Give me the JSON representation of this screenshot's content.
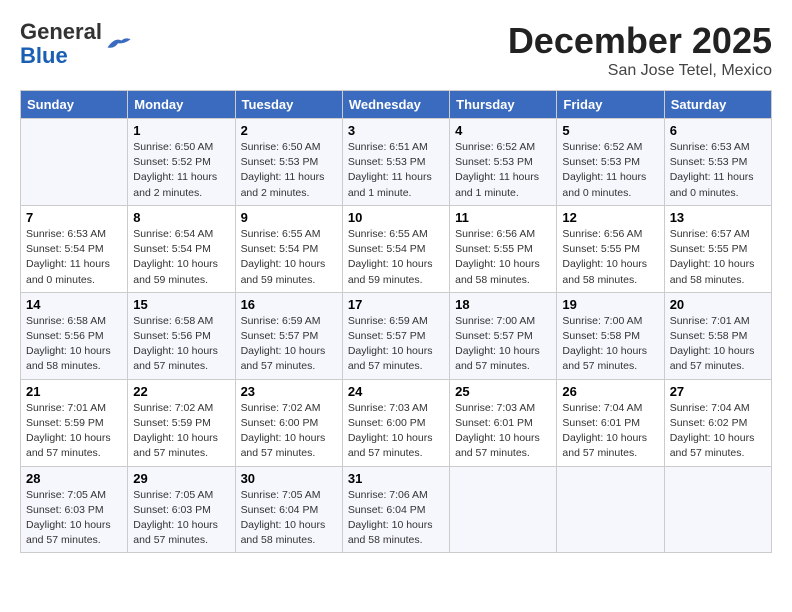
{
  "header": {
    "logo_general": "General",
    "logo_blue": "Blue",
    "month_title": "December 2025",
    "location": "San Jose Tetel, Mexico"
  },
  "weekdays": [
    "Sunday",
    "Monday",
    "Tuesday",
    "Wednesday",
    "Thursday",
    "Friday",
    "Saturday"
  ],
  "weeks": [
    [
      {
        "day": "",
        "sunrise": "",
        "sunset": "",
        "daylight": ""
      },
      {
        "day": "1",
        "sunrise": "Sunrise: 6:50 AM",
        "sunset": "Sunset: 5:52 PM",
        "daylight": "Daylight: 11 hours and 2 minutes."
      },
      {
        "day": "2",
        "sunrise": "Sunrise: 6:50 AM",
        "sunset": "Sunset: 5:53 PM",
        "daylight": "Daylight: 11 hours and 2 minutes."
      },
      {
        "day": "3",
        "sunrise": "Sunrise: 6:51 AM",
        "sunset": "Sunset: 5:53 PM",
        "daylight": "Daylight: 11 hours and 1 minute."
      },
      {
        "day": "4",
        "sunrise": "Sunrise: 6:52 AM",
        "sunset": "Sunset: 5:53 PM",
        "daylight": "Daylight: 11 hours and 1 minute."
      },
      {
        "day": "5",
        "sunrise": "Sunrise: 6:52 AM",
        "sunset": "Sunset: 5:53 PM",
        "daylight": "Daylight: 11 hours and 0 minutes."
      },
      {
        "day": "6",
        "sunrise": "Sunrise: 6:53 AM",
        "sunset": "Sunset: 5:53 PM",
        "daylight": "Daylight: 11 hours and 0 minutes."
      }
    ],
    [
      {
        "day": "7",
        "sunrise": "Sunrise: 6:53 AM",
        "sunset": "Sunset: 5:54 PM",
        "daylight": "Daylight: 11 hours and 0 minutes."
      },
      {
        "day": "8",
        "sunrise": "Sunrise: 6:54 AM",
        "sunset": "Sunset: 5:54 PM",
        "daylight": "Daylight: 10 hours and 59 minutes."
      },
      {
        "day": "9",
        "sunrise": "Sunrise: 6:55 AM",
        "sunset": "Sunset: 5:54 PM",
        "daylight": "Daylight: 10 hours and 59 minutes."
      },
      {
        "day": "10",
        "sunrise": "Sunrise: 6:55 AM",
        "sunset": "Sunset: 5:54 PM",
        "daylight": "Daylight: 10 hours and 59 minutes."
      },
      {
        "day": "11",
        "sunrise": "Sunrise: 6:56 AM",
        "sunset": "Sunset: 5:55 PM",
        "daylight": "Daylight: 10 hours and 58 minutes."
      },
      {
        "day": "12",
        "sunrise": "Sunrise: 6:56 AM",
        "sunset": "Sunset: 5:55 PM",
        "daylight": "Daylight: 10 hours and 58 minutes."
      },
      {
        "day": "13",
        "sunrise": "Sunrise: 6:57 AM",
        "sunset": "Sunset: 5:55 PM",
        "daylight": "Daylight: 10 hours and 58 minutes."
      }
    ],
    [
      {
        "day": "14",
        "sunrise": "Sunrise: 6:58 AM",
        "sunset": "Sunset: 5:56 PM",
        "daylight": "Daylight: 10 hours and 58 minutes."
      },
      {
        "day": "15",
        "sunrise": "Sunrise: 6:58 AM",
        "sunset": "Sunset: 5:56 PM",
        "daylight": "Daylight: 10 hours and 57 minutes."
      },
      {
        "day": "16",
        "sunrise": "Sunrise: 6:59 AM",
        "sunset": "Sunset: 5:57 PM",
        "daylight": "Daylight: 10 hours and 57 minutes."
      },
      {
        "day": "17",
        "sunrise": "Sunrise: 6:59 AM",
        "sunset": "Sunset: 5:57 PM",
        "daylight": "Daylight: 10 hours and 57 minutes."
      },
      {
        "day": "18",
        "sunrise": "Sunrise: 7:00 AM",
        "sunset": "Sunset: 5:57 PM",
        "daylight": "Daylight: 10 hours and 57 minutes."
      },
      {
        "day": "19",
        "sunrise": "Sunrise: 7:00 AM",
        "sunset": "Sunset: 5:58 PM",
        "daylight": "Daylight: 10 hours and 57 minutes."
      },
      {
        "day": "20",
        "sunrise": "Sunrise: 7:01 AM",
        "sunset": "Sunset: 5:58 PM",
        "daylight": "Daylight: 10 hours and 57 minutes."
      }
    ],
    [
      {
        "day": "21",
        "sunrise": "Sunrise: 7:01 AM",
        "sunset": "Sunset: 5:59 PM",
        "daylight": "Daylight: 10 hours and 57 minutes."
      },
      {
        "day": "22",
        "sunrise": "Sunrise: 7:02 AM",
        "sunset": "Sunset: 5:59 PM",
        "daylight": "Daylight: 10 hours and 57 minutes."
      },
      {
        "day": "23",
        "sunrise": "Sunrise: 7:02 AM",
        "sunset": "Sunset: 6:00 PM",
        "daylight": "Daylight: 10 hours and 57 minutes."
      },
      {
        "day": "24",
        "sunrise": "Sunrise: 7:03 AM",
        "sunset": "Sunset: 6:00 PM",
        "daylight": "Daylight: 10 hours and 57 minutes."
      },
      {
        "day": "25",
        "sunrise": "Sunrise: 7:03 AM",
        "sunset": "Sunset: 6:01 PM",
        "daylight": "Daylight: 10 hours and 57 minutes."
      },
      {
        "day": "26",
        "sunrise": "Sunrise: 7:04 AM",
        "sunset": "Sunset: 6:01 PM",
        "daylight": "Daylight: 10 hours and 57 minutes."
      },
      {
        "day": "27",
        "sunrise": "Sunrise: 7:04 AM",
        "sunset": "Sunset: 6:02 PM",
        "daylight": "Daylight: 10 hours and 57 minutes."
      }
    ],
    [
      {
        "day": "28",
        "sunrise": "Sunrise: 7:05 AM",
        "sunset": "Sunset: 6:03 PM",
        "daylight": "Daylight: 10 hours and 57 minutes."
      },
      {
        "day": "29",
        "sunrise": "Sunrise: 7:05 AM",
        "sunset": "Sunset: 6:03 PM",
        "daylight": "Daylight: 10 hours and 57 minutes."
      },
      {
        "day": "30",
        "sunrise": "Sunrise: 7:05 AM",
        "sunset": "Sunset: 6:04 PM",
        "daylight": "Daylight: 10 hours and 58 minutes."
      },
      {
        "day": "31",
        "sunrise": "Sunrise: 7:06 AM",
        "sunset": "Sunset: 6:04 PM",
        "daylight": "Daylight: 10 hours and 58 minutes."
      },
      {
        "day": "",
        "sunrise": "",
        "sunset": "",
        "daylight": ""
      },
      {
        "day": "",
        "sunrise": "",
        "sunset": "",
        "daylight": ""
      },
      {
        "day": "",
        "sunrise": "",
        "sunset": "",
        "daylight": ""
      }
    ]
  ]
}
